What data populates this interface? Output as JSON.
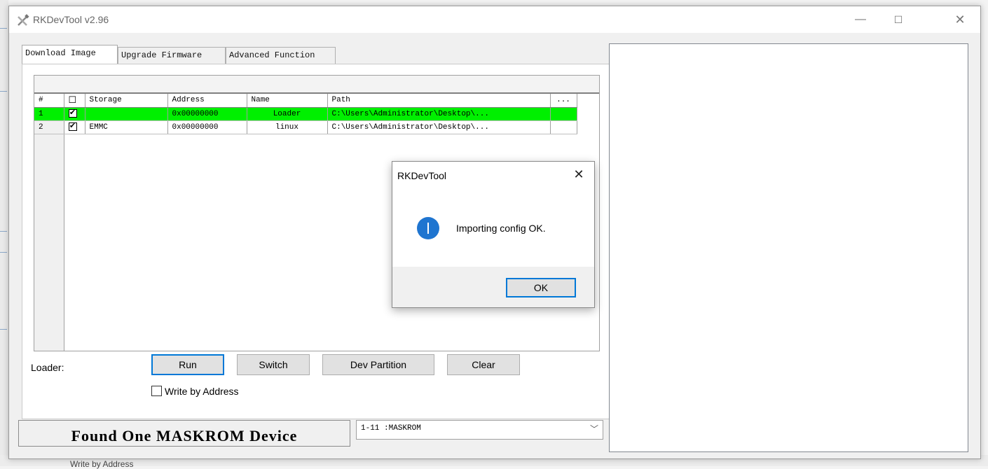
{
  "window": {
    "title": "RKDevTool v2.96"
  },
  "tabs": [
    {
      "label": "Download Image"
    },
    {
      "label": "Upgrade Firmware"
    },
    {
      "label": "Advanced Function"
    }
  ],
  "grid": {
    "headers": [
      "#",
      "☐",
      "Storage",
      "Address",
      "Name",
      "Path",
      "..."
    ],
    "rows": [
      {
        "num": "1",
        "checked": "✔",
        "storage": "",
        "address": "0x00000000",
        "name": "Loader",
        "path": "C:\\Users\\Administrator\\Desktop\\...",
        "selected": true
      },
      {
        "num": "2",
        "checked": "✔",
        "storage": "EMMC",
        "address": "0x00000000",
        "name": "linux",
        "path": "C:\\Users\\Administrator\\Desktop\\...",
        "selected": false
      }
    ]
  },
  "loader_label": "Loader:",
  "buttons": {
    "run": "Run",
    "switch": "Switch",
    "dev_partition": "Dev Partition",
    "clear": "Clear"
  },
  "write_by_address": "Write by Address",
  "status": {
    "text": "Found One MASKROM Device"
  },
  "device_select": {
    "value": "1-11 :MASKROM"
  },
  "dialog": {
    "title": "RKDevTool",
    "message": "Importing config OK.",
    "ok": "OK"
  },
  "background": {
    "partial_text": "Write by Address"
  },
  "colors": {
    "selected_row": "#00f000",
    "accent": "#0078d7",
    "info_icon": "#1f75d0"
  }
}
